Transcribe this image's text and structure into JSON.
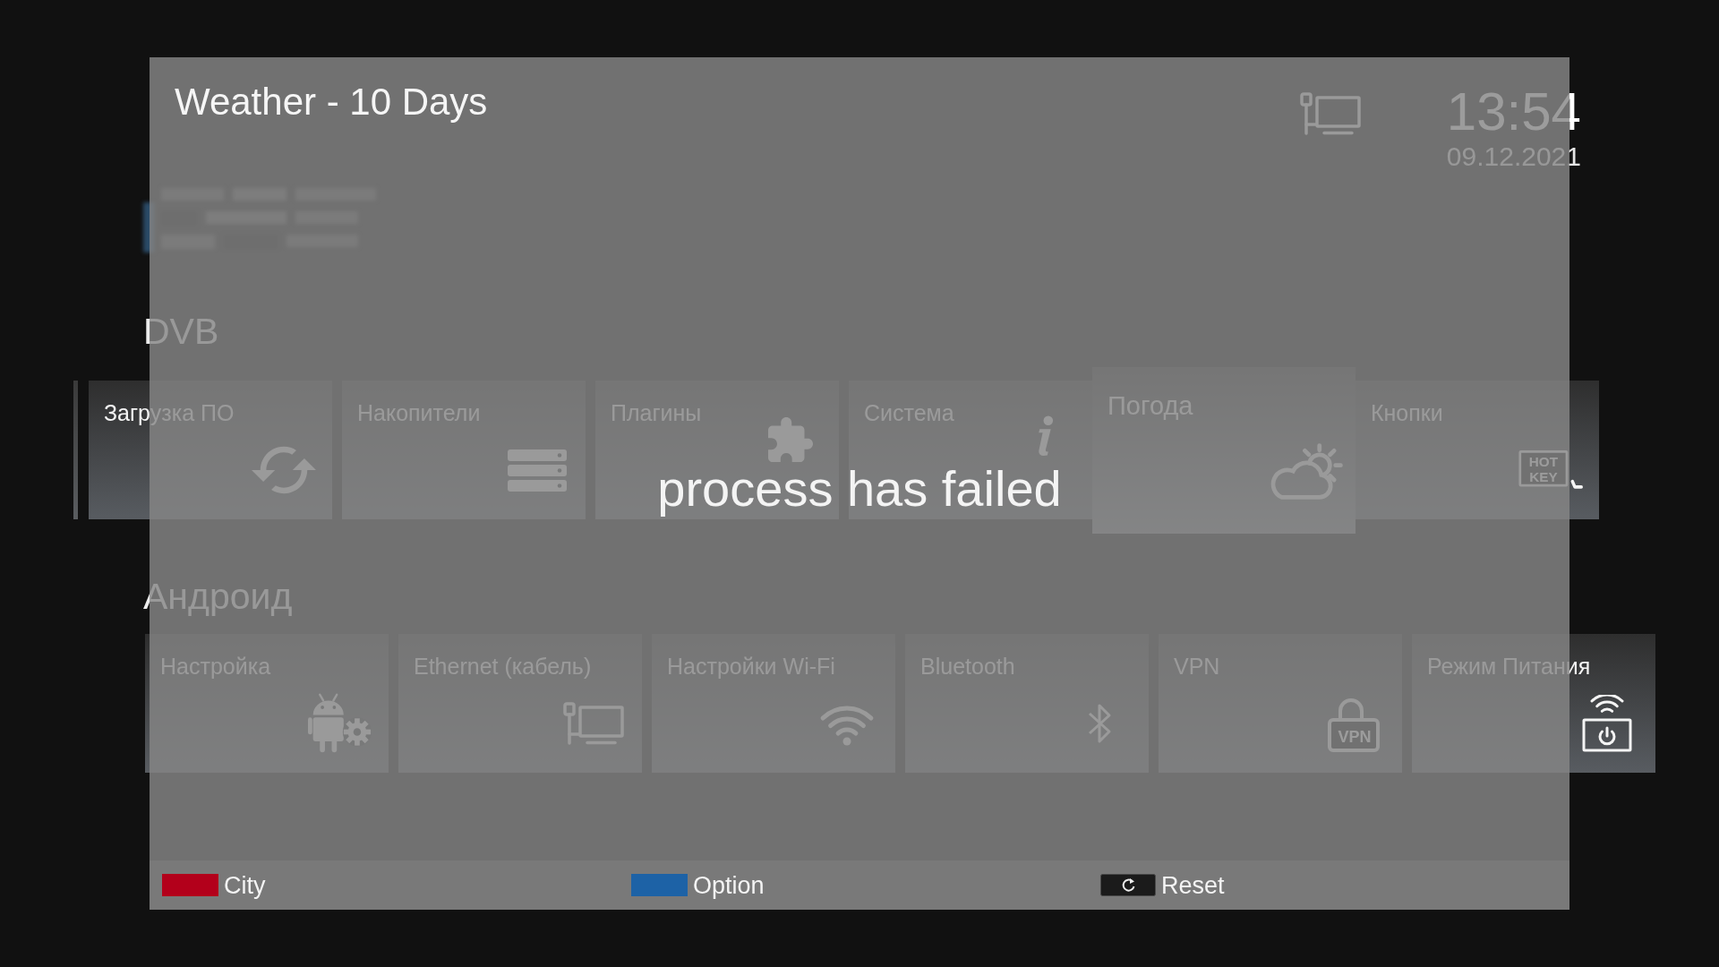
{
  "menu": {
    "time": "13:54",
    "date": "09.12.2021",
    "sections": [
      {
        "title": "DVB",
        "tiles": [
          {
            "label": "Загрузка ПО",
            "selected": false
          },
          {
            "label": "Накопители",
            "selected": false
          },
          {
            "label": "Плагины",
            "selected": false
          },
          {
            "label": "Система",
            "selected": false
          },
          {
            "label": "Погода",
            "selected": true
          },
          {
            "label": "Кнопки",
            "selected": false,
            "icon_text": [
              "HOT",
              "KEY"
            ]
          }
        ]
      },
      {
        "title": "Андроид",
        "tiles": [
          {
            "label": "Настройка",
            "selected": false
          },
          {
            "label": "Ethernet (кабель)",
            "selected": false
          },
          {
            "label": "Настройки Wi-Fi",
            "selected": false
          },
          {
            "label": "Bluetooth",
            "selected": false
          },
          {
            "label": "VPN",
            "selected": false,
            "icon_text": [
              "VPN"
            ]
          },
          {
            "label": "Режим Питания",
            "selected": false
          }
        ]
      }
    ]
  },
  "dialog": {
    "title": "Weather - 10 Days",
    "message": "process has failed",
    "hints": [
      {
        "kind": "swatch",
        "color": "#b3001b",
        "label": "City"
      },
      {
        "kind": "swatch",
        "color": "#1d62a6",
        "label": "Option"
      },
      {
        "kind": "key",
        "label": "Reset"
      }
    ]
  }
}
